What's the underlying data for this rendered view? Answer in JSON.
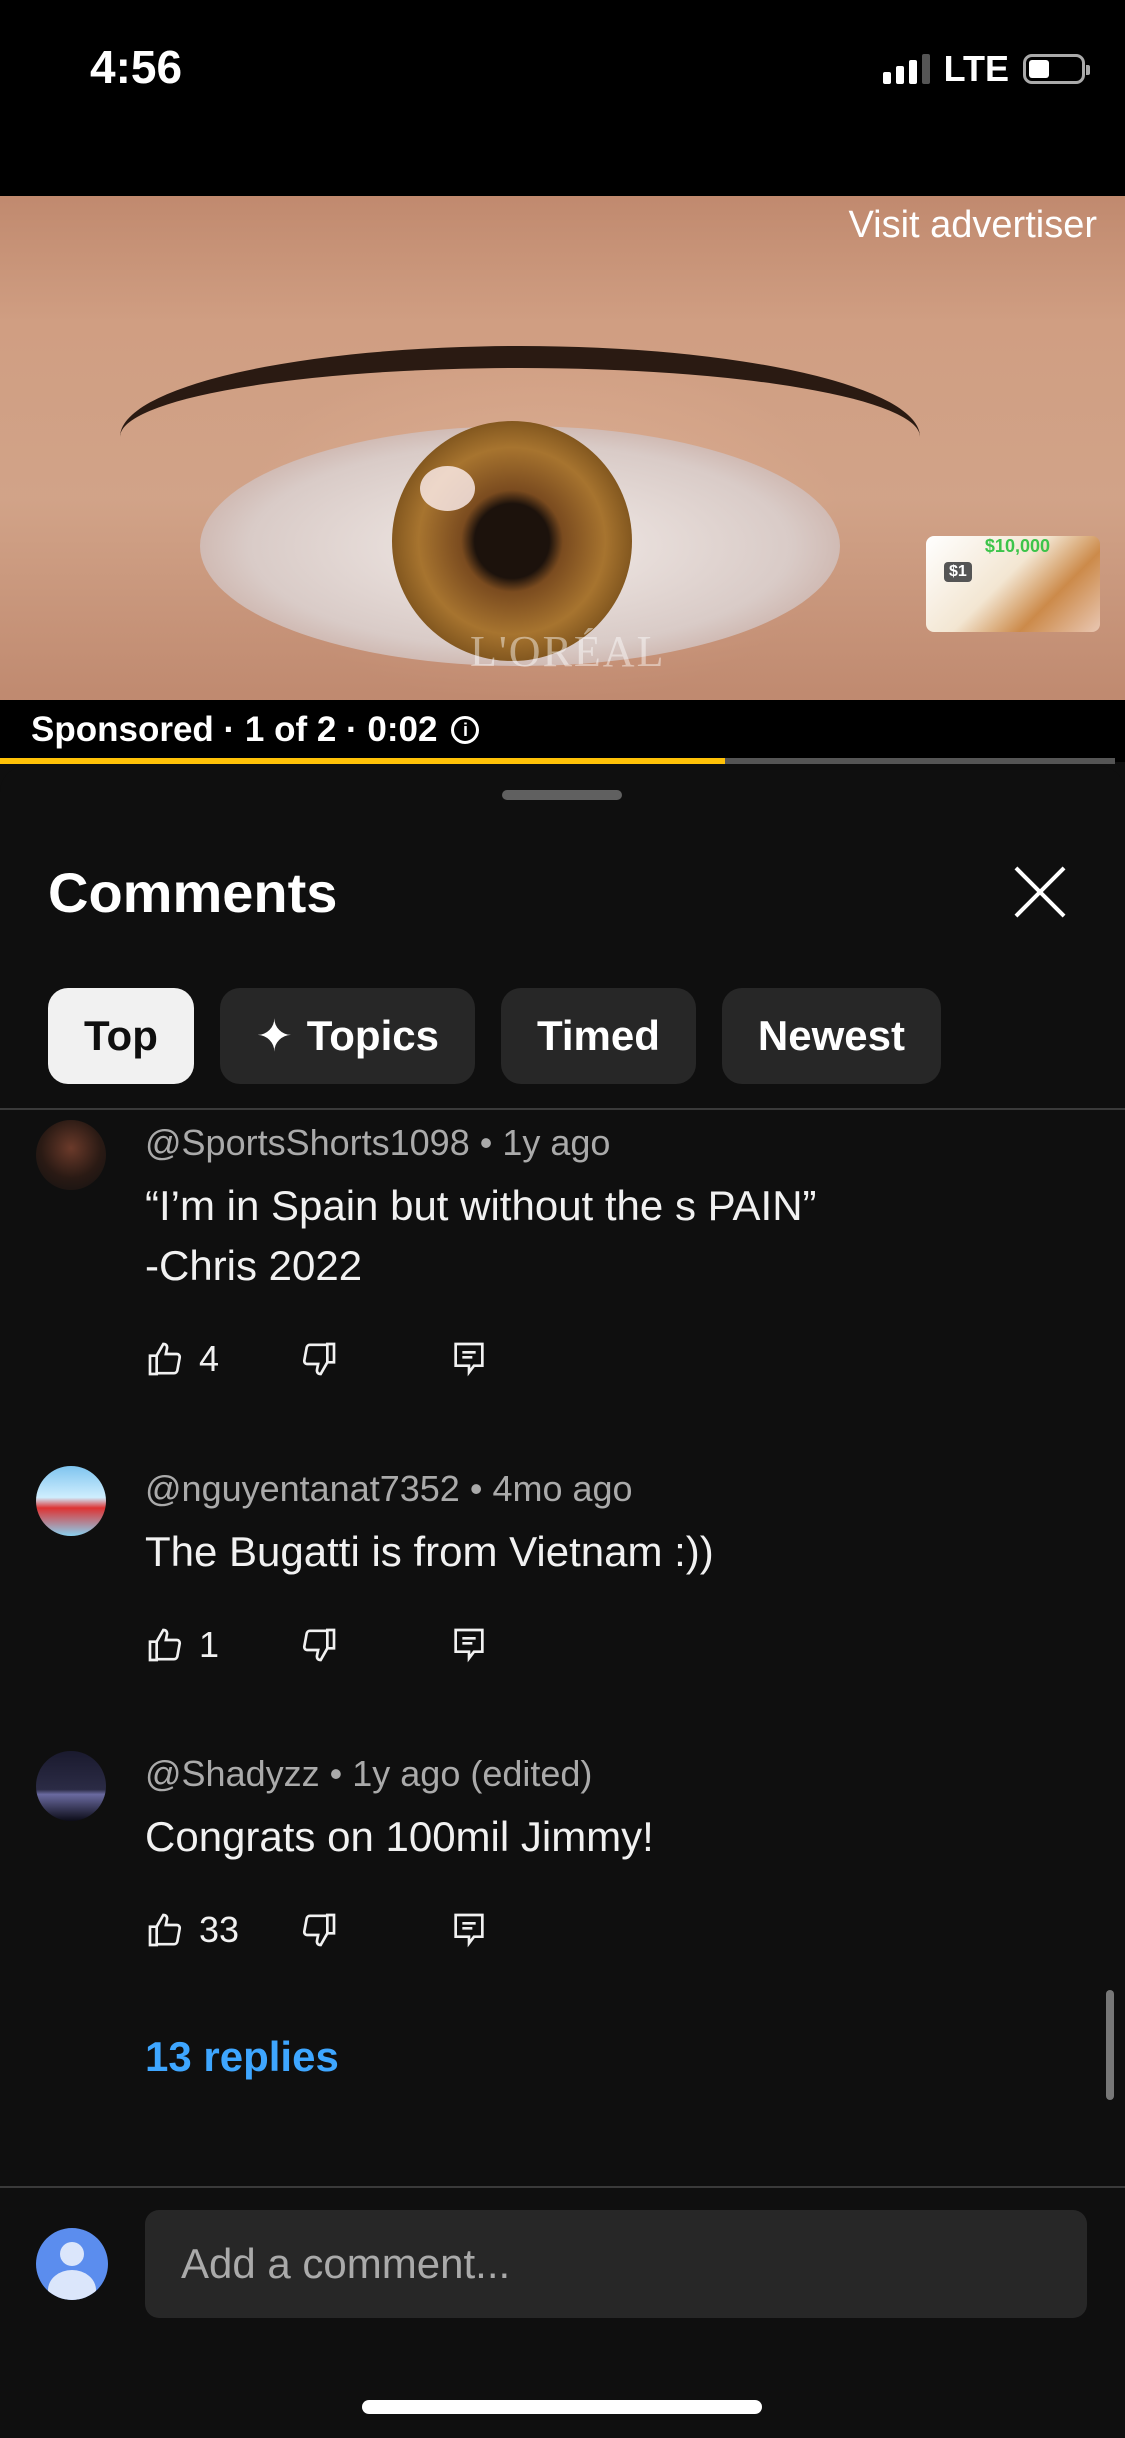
{
  "status_bar": {
    "time": "4:56",
    "network": "LTE"
  },
  "ad": {
    "visit_label": "Visit advertiser",
    "brand_watermark": "L'ORÉAL",
    "sponsored_text": "Sponsored · 1 of 2 · 0:02",
    "info_icon": "info-icon",
    "progress": 0.65,
    "promo_price": "$10,000",
    "promo_small": "$1"
  },
  "comments_sheet": {
    "title": "Comments",
    "close_icon": "close-icon",
    "chips": [
      {
        "label": "Top",
        "active": true
      },
      {
        "label": "Topics",
        "icon": "sparkle-icon"
      },
      {
        "label": "Timed"
      },
      {
        "label": "Newest"
      }
    ],
    "comments": [
      {
        "handle": "@SportsShorts1098",
        "age": "1y ago",
        "text": "“I’m in Spain but without the s PAIN”\n-Chris 2022",
        "likes": "4"
      },
      {
        "handle": "@nguyentanat7352",
        "age": "4mo ago",
        "text": "The Bugatti is from Vietnam :))",
        "likes": "1"
      },
      {
        "handle": "@Shadyzz",
        "age": "1y ago (edited)",
        "text": "Congrats on 100mil Jimmy!",
        "likes": "33",
        "replies": "13 replies"
      }
    ],
    "composer": {
      "placeholder": "Add a comment..."
    }
  },
  "colors": {
    "accent_link": "#3ea6ff",
    "progress": "#ffc107",
    "background": "#0f0f0f"
  }
}
